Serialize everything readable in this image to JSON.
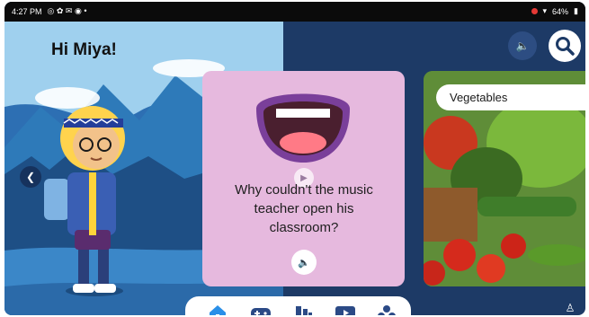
{
  "status_bar": {
    "time": "4:27 PM",
    "battery": "64%"
  },
  "greeting": "Hi Miya!",
  "joke_card": {
    "text": "Why couldn't the music teacher open his classroom?"
  },
  "category_card": {
    "label": "Vegetables"
  },
  "icons": {
    "sound": "speaker-icon",
    "search": "search-icon",
    "left": "chevron-left-icon",
    "home": "home-icon",
    "games": "gamepad-icon",
    "books": "books-icon",
    "video": "video-icon",
    "puzzle": "puzzle-icon",
    "corner": "character-icon"
  },
  "colors": {
    "card_pink": "#e6b9de",
    "night_blue": "#1d3a66",
    "nav_accent": "#2b4a86"
  }
}
